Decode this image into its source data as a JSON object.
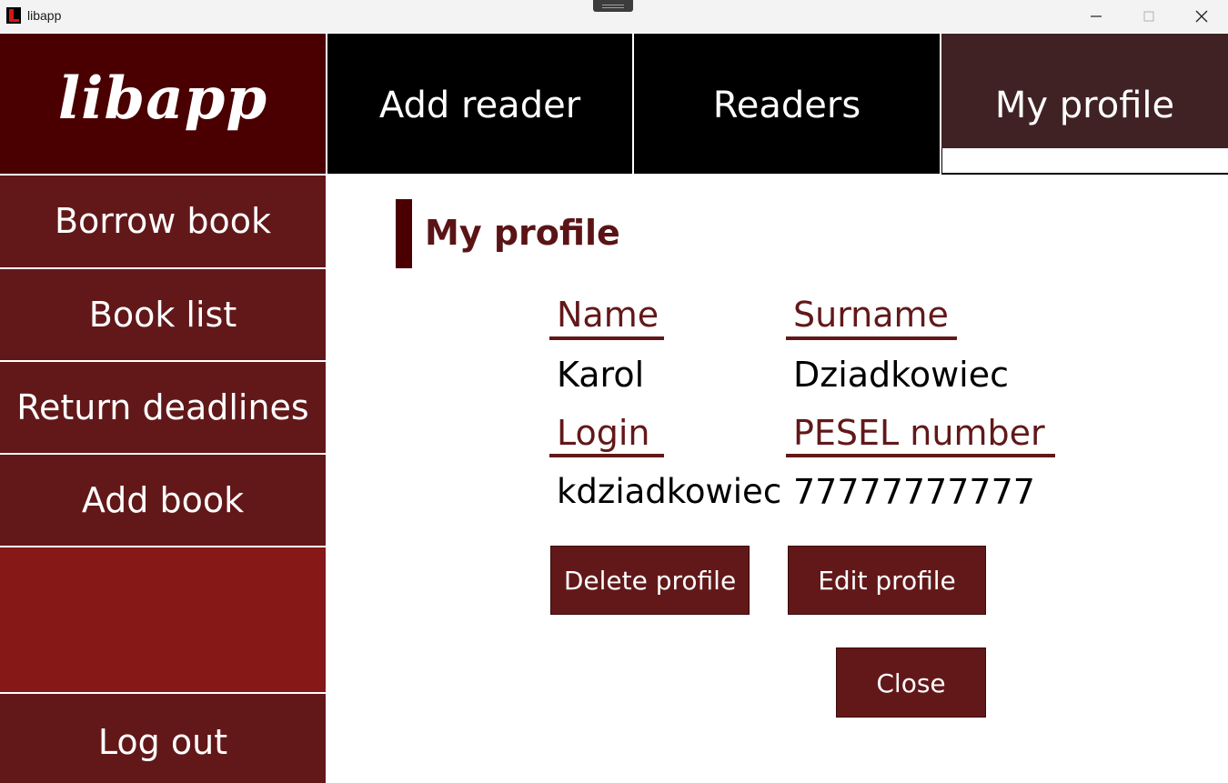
{
  "window": {
    "title": "libapp",
    "icon": "app-logo-icon",
    "controls": [
      "minimize-icon",
      "maximize-icon",
      "close-icon"
    ]
  },
  "logo": {
    "text": "libapp"
  },
  "nav": {
    "tabs": [
      {
        "label": "Add reader",
        "active": false
      },
      {
        "label": "Readers",
        "active": false
      },
      {
        "label": "My profile",
        "active": true
      }
    ]
  },
  "sidebar": {
    "items": [
      {
        "label": "Borrow book"
      },
      {
        "label": "Book list"
      },
      {
        "label": "Return deadlines"
      },
      {
        "label": "Add book"
      }
    ],
    "logout_label": "Log out"
  },
  "main": {
    "heading": "My profile",
    "fields": {
      "name_label": "Name",
      "name_value": "Karol",
      "surname_label": "Surname",
      "surname_value": "Dziadkowiec",
      "login_label": "Login",
      "login_value": "kdziadkowiec",
      "pesel_label": "PESEL number",
      "pesel_value": "77777777777"
    },
    "buttons": {
      "delete_label": "Delete profile",
      "edit_label": "Edit profile",
      "close_label": "Close"
    }
  },
  "colors": {
    "logo_bg": "#4a0000",
    "nav_bg": "#000000",
    "nav_active_bg": "#412224",
    "sidebar_bg": "#621819",
    "sidebar_spacer_bg": "#861818",
    "accent": "#621819"
  }
}
